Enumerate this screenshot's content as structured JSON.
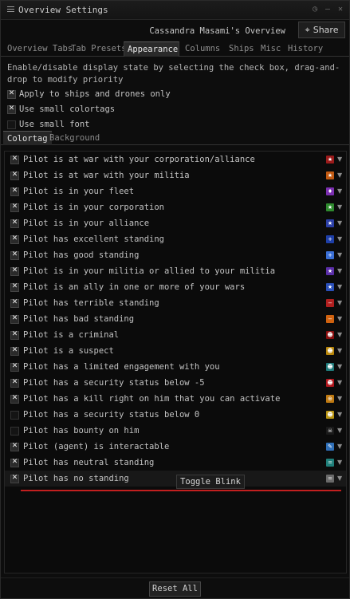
{
  "window": {
    "title": "Overview Settings",
    "controls": [
      "◷",
      "–",
      "✕"
    ]
  },
  "header": {
    "owner": "Cassandra Masami's Overview",
    "share_label": "Share",
    "share_icon": "⌖"
  },
  "tabs": [
    {
      "label": "Overview Tabs",
      "active": false
    },
    {
      "label": "Tab Presets",
      "active": false
    },
    {
      "label": "Appearance",
      "active": true
    },
    {
      "label": "Columns",
      "active": false
    },
    {
      "label": "Ships",
      "active": false
    },
    {
      "label": "Misc",
      "active": false
    },
    {
      "label": "History",
      "active": false
    }
  ],
  "description": "Enable/disable display state by selecting the check box, drag-and-drop to modify priority",
  "options": [
    {
      "label": "Apply to ships and drones only",
      "checked": true
    },
    {
      "label": "Use small colortags",
      "checked": true
    },
    {
      "label": "Use small font",
      "checked": false
    }
  ],
  "subtabs": [
    {
      "label": "Colortag",
      "active": true
    },
    {
      "label": "Background",
      "active": false
    }
  ],
  "colortags": [
    {
      "label": "Pilot is at war with your corporation/alliance",
      "checked": true,
      "color": "#9b1b1b",
      "glyph": "★"
    },
    {
      "label": "Pilot is at war with your militia",
      "checked": true,
      "color": "#c25a12",
      "glyph": "★"
    },
    {
      "label": "Pilot is in your fleet",
      "checked": true,
      "color": "#7b2fb0",
      "glyph": "♦"
    },
    {
      "label": "Pilot is in your corporation",
      "checked": true,
      "color": "#2e8a2e",
      "glyph": "★"
    },
    {
      "label": "Pilot is in your alliance",
      "checked": true,
      "color": "#2b3fa6",
      "glyph": "★"
    },
    {
      "label": "Pilot has excellent standing",
      "checked": true,
      "color": "#1e3fa8",
      "glyph": "+"
    },
    {
      "label": "Pilot has good standing",
      "checked": true,
      "color": "#3a6fd6",
      "glyph": "+"
    },
    {
      "label": "Pilot is in your militia or allied to your militia",
      "checked": true,
      "color": "#5a2ea8",
      "glyph": "★"
    },
    {
      "label": "Pilot is an ally in one or more of your wars",
      "checked": true,
      "color": "#2a4fb8",
      "glyph": "★"
    },
    {
      "label": "Pilot has terrible standing",
      "checked": true,
      "color": "#b01f1f",
      "glyph": "−"
    },
    {
      "label": "Pilot has bad standing",
      "checked": true,
      "color": "#d0620f",
      "glyph": "−"
    },
    {
      "label": "Pilot is a criminal",
      "checked": true,
      "color": "#8a0f0f",
      "glyph": "☻"
    },
    {
      "label": "Pilot is a suspect",
      "checked": true,
      "color": "#b8860b",
      "glyph": "☻"
    },
    {
      "label": "Pilot has a limited engagement with you",
      "checked": true,
      "color": "#1f7a7a",
      "glyph": "☻"
    },
    {
      "label": "Pilot has a security status below -5",
      "checked": true,
      "color": "#b0181e",
      "glyph": "☻"
    },
    {
      "label": "Pilot has a kill right on him that you can activate",
      "checked": true,
      "color": "#c07a12",
      "glyph": "⊕"
    },
    {
      "label": "Pilot has a security status below 0",
      "checked": false,
      "color": "#b89412",
      "glyph": "☻"
    },
    {
      "label": "Pilot has bounty on him",
      "checked": false,
      "color": "#1a1a1a",
      "glyph": "☠"
    },
    {
      "label": "Pilot (agent) is interactable",
      "checked": true,
      "color": "#2f6fb8",
      "glyph": "✎"
    },
    {
      "label": "Pilot has neutral standing",
      "checked": true,
      "color": "#1f7f7a",
      "glyph": "="
    },
    {
      "label": "Pilot has no standing",
      "checked": true,
      "color": "#6a6a6a",
      "glyph": "="
    }
  ],
  "tooltip": "Toggle Blink",
  "footer": {
    "reset_label": "Reset All"
  }
}
